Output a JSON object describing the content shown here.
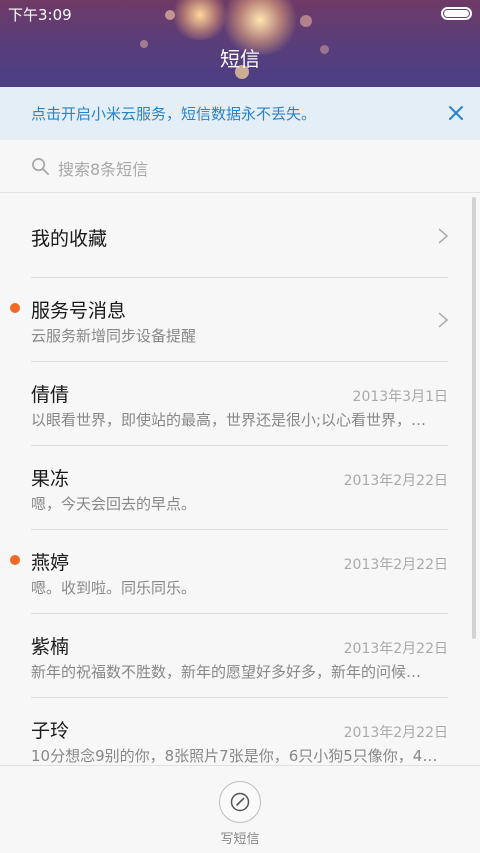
{
  "status_bar": {
    "time": "下午3:09"
  },
  "header": {
    "title": "短信"
  },
  "banner": {
    "text": "点击开启小米云服务，短信数据永不丢失。"
  },
  "search": {
    "placeholder": "搜索8条短信"
  },
  "conversations": [
    {
      "name": "我的收藏",
      "preview": "",
      "date": "",
      "unread": false,
      "has_chevron": true
    },
    {
      "name": "服务号消息",
      "preview": "云服务新增同步设备提醒",
      "date": "",
      "unread": true,
      "has_chevron": true
    },
    {
      "name": "倩倩",
      "preview": "以眼看世界，即使站的最高，世界还是很小;以心看世界，…",
      "date": "2013年3月1日",
      "unread": false,
      "has_chevron": false
    },
    {
      "name": "果冻",
      "preview": "嗯，今天会回去的早点。",
      "date": "2013年2月22日",
      "unread": false,
      "has_chevron": false
    },
    {
      "name": "燕婷",
      "preview": "嗯。收到啦。同乐同乐。",
      "date": "2013年2月22日",
      "unread": true,
      "has_chevron": false
    },
    {
      "name": "紫楠",
      "preview": "新年的祝福数不胜数，新年的愿望好多好多，新年的问候…",
      "date": "2013年2月22日",
      "unread": false,
      "has_chevron": false
    },
    {
      "name": "子玲",
      "preview": "10分想念9别的你，8张照片7张是你，6只小狗5只像你，4…",
      "date": "2013年2月22日",
      "unread": false,
      "has_chevron": false
    }
  ],
  "bottom": {
    "compose_label": "写短信"
  },
  "colors": {
    "accent": "#2a83c8",
    "unread_dot": "#f06a25",
    "banner_bg": "#e4eef6"
  },
  "icons": {
    "search": "search-icon",
    "close": "close-icon",
    "chevron": "chevron-right-icon",
    "compose": "compose-icon",
    "battery": "battery-icon"
  }
}
